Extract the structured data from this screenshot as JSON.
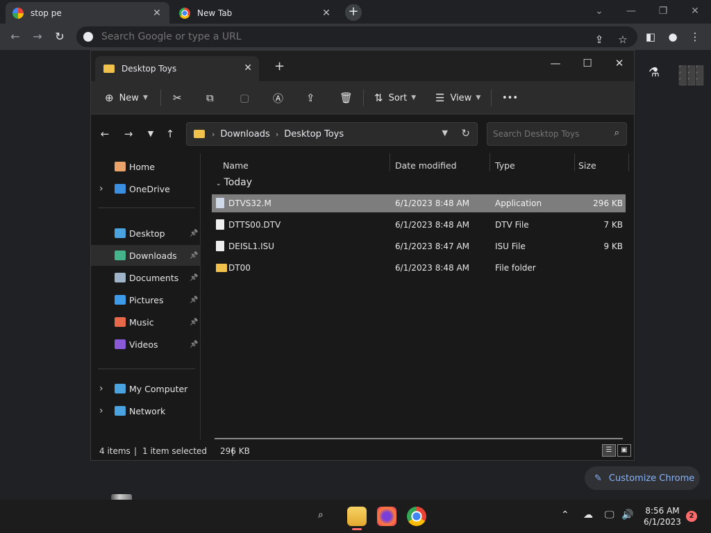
{
  "browser": {
    "tabs": [
      {
        "title": "stop pe",
        "close": "✕"
      },
      {
        "title": "New Tab",
        "close": "✕"
      }
    ],
    "new_tab_glyph": "+",
    "window_controls": [
      "⌄",
      "—",
      "❐",
      "✕"
    ],
    "nav": {
      "back": "←",
      "forward": "→",
      "reload": "↻"
    },
    "omnibox_placeholder": "Search Google or type a URL",
    "toolbar_icons": [
      "share-icon",
      "star-icon",
      "side-panel-icon",
      "profile-icon",
      "menu-icon"
    ],
    "ntp_icons": {
      "labs": "⚗",
      "apps": "⋮⋮⋮"
    },
    "customize_label": "Customize Chrome",
    "customize_icon": "✎"
  },
  "explorer": {
    "tab_title": "Desktop Toys",
    "window_controls": {
      "minimize": "—",
      "maximize": "☐",
      "close": "✕"
    },
    "command_bar": {
      "new_label": "New",
      "sort_label": "Sort",
      "view_label": "View",
      "more_label": "•••"
    },
    "address": {
      "crumbs": [
        "Downloads",
        "Desktop Toys"
      ],
      "separator": "›"
    },
    "search_placeholder": "Search Desktop Toys",
    "sidebar": [
      {
        "label": "Home",
        "icon": "home-icon",
        "color": "#e8a26a",
        "expandable": false,
        "pinned": false
      },
      {
        "label": "OneDrive",
        "icon": "cloud-icon",
        "color": "#3b8fe0",
        "expandable": true,
        "pinned": false
      },
      {
        "label": "Desktop",
        "icon": "desktop-icon",
        "color": "#4aa3df",
        "expandable": false,
        "pinned": true
      },
      {
        "label": "Downloads",
        "icon": "download-icon",
        "color": "#45b48a",
        "expandable": false,
        "pinned": true,
        "selected": true
      },
      {
        "label": "Documents",
        "icon": "document-icon",
        "color": "#9fb4c7",
        "expandable": false,
        "pinned": true
      },
      {
        "label": "Pictures",
        "icon": "picture-icon",
        "color": "#3d9be9",
        "expandable": false,
        "pinned": true
      },
      {
        "label": "Music",
        "icon": "music-icon",
        "color": "#e66a4a",
        "expandable": false,
        "pinned": true
      },
      {
        "label": "Videos",
        "icon": "video-icon",
        "color": "#8a5ad8",
        "expandable": false,
        "pinned": true
      },
      {
        "label": "My Computer",
        "icon": "computer-icon",
        "color": "#4aa3df",
        "expandable": true,
        "pinned": false
      },
      {
        "label": "Network",
        "icon": "network-icon",
        "color": "#4aa3df",
        "expandable": true,
        "pinned": false
      }
    ],
    "columns": [
      "Name",
      "Date modified",
      "Type",
      "Size"
    ],
    "group_label": "Today",
    "files": [
      {
        "name": "DTVS32.M",
        "date": "6/1/2023 8:48 AM",
        "type": "Application",
        "size": "296 KB",
        "kind": "app",
        "selected": true
      },
      {
        "name": "DTTS00.DTV",
        "date": "6/1/2023 8:48 AM",
        "type": "DTV File",
        "size": "7 KB",
        "kind": "file",
        "selected": false
      },
      {
        "name": "DEISL1.ISU",
        "date": "6/1/2023 8:47 AM",
        "type": "ISU File",
        "size": "9 KB",
        "kind": "file",
        "selected": false
      },
      {
        "name": "DT00",
        "date": "6/1/2023 8:48 AM",
        "type": "File folder",
        "size": "",
        "kind": "folder",
        "selected": false
      }
    ],
    "status": {
      "items": "4 items",
      "selection": "1 item selected",
      "selection_size": "296 KB",
      "divider": "|"
    }
  },
  "taskbar": {
    "clock_time": "8:56 AM",
    "clock_date": "6/1/2023",
    "notification_count": "2",
    "tray": {
      "chevron": "⌃",
      "network": "🖵",
      "volume": "🔊"
    }
  },
  "colors": {
    "accent_link": "#8ab4f8",
    "folder": "#f0c24b",
    "selection": "#7d7d7d"
  }
}
